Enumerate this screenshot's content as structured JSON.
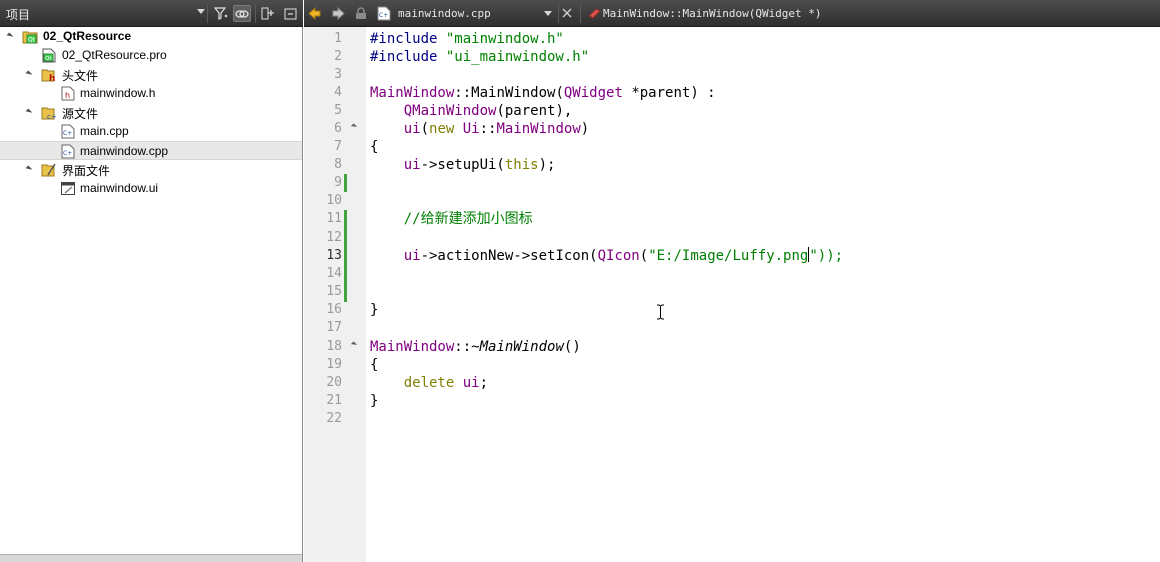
{
  "left_panel": {
    "title": "项目",
    "tree": [
      {
        "label": "02_QtResource",
        "bold": true,
        "icon": "qt-project-icon"
      },
      {
        "label": "02_QtResource.pro",
        "icon": "pro-file-icon"
      },
      {
        "label": "头文件",
        "icon": "headers-folder-icon"
      },
      {
        "label": "mainwindow.h",
        "icon": "header-file-icon"
      },
      {
        "label": "源文件",
        "icon": "sources-folder-icon"
      },
      {
        "label": "main.cpp",
        "icon": "cpp-file-icon"
      },
      {
        "label": "mainwindow.cpp",
        "icon": "cpp-file-icon",
        "selected": true
      },
      {
        "label": "界面文件",
        "icon": "forms-folder-icon"
      },
      {
        "label": "mainwindow.ui",
        "icon": "ui-file-icon"
      }
    ]
  },
  "editor_toolbar": {
    "file_name": "mainwindow.cpp",
    "symbol_name": "MainWindow::MainWindow(QWidget *)"
  },
  "editor": {
    "current_line": 13,
    "line_numbers": [
      "1",
      "2",
      "3",
      "4",
      "5",
      "6",
      "7",
      "8",
      "9",
      "10",
      "11",
      "12",
      "13",
      "14",
      "15",
      "16",
      "17",
      "18",
      "19",
      "20",
      "21",
      "22"
    ],
    "code": {
      "l1_a": "#include ",
      "l1_b": "\"mainwindow.h\"",
      "l2_a": "#include ",
      "l2_b": "\"ui_mainwindow.h\"",
      "l4_a": "MainWindow",
      "l4_b": "::MainWindow(",
      "l4_c": "QWidget",
      "l4_d": " *parent) :",
      "l5_a": "    ",
      "l5_b": "QMainWindow",
      "l5_c": "(parent),",
      "l6_a": "    ",
      "l6_b": "ui",
      "l6_c": "(",
      "l6_d": "new",
      "l6_e": " ",
      "l6_f": "Ui",
      "l6_g": "::",
      "l6_h": "MainWindow",
      "l6_i": ")",
      "l7": "{",
      "l8_a": "    ",
      "l8_b": "ui",
      "l8_c": "->setupUi(",
      "l8_d": "this",
      "l8_e": ");",
      "l11_a": "    ",
      "l11_b": "//给新建添加小图标",
      "l13_a": "    ",
      "l13_b": "ui",
      "l13_c": "->actionNew->setIcon(",
      "l13_d": "QIcon",
      "l13_e": "(",
      "l13_f": "\"E:/Image/Luffy.png",
      "l13_g": "\"));",
      "l16": "}",
      "l18_a": "MainWindow",
      "l18_b": "::~",
      "l18_c": "MainWindow",
      "l18_d": "()",
      "l19": "{",
      "l20_a": "    ",
      "l20_b": "delete",
      "l20_c": " ",
      "l20_d": "ui",
      "l20_e": ";",
      "l21": "}"
    }
  },
  "colors": {
    "keyword": "#808000",
    "preprocessor": "#000080",
    "string": "#008000",
    "type": "#800080",
    "comment": "#008000",
    "toolbar_bg": "#3a3a3a",
    "revision_bar": "#3fa63f"
  }
}
